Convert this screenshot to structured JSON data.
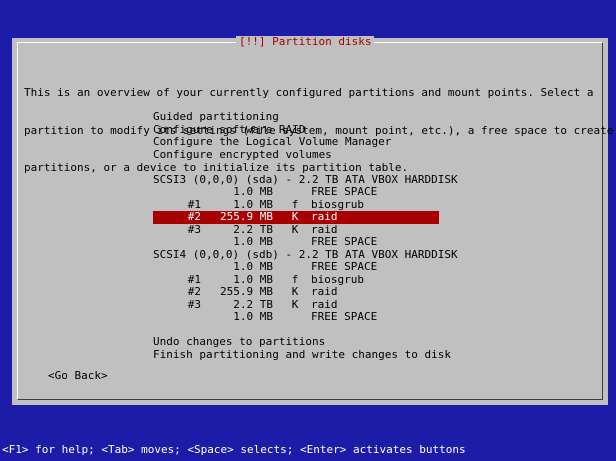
{
  "dialog": {
    "title": "[!!] Partition disks",
    "intro": [
      "This is an overview of your currently configured partitions and mount points. Select a",
      "partition to modify its settings (file system, mount point, etc.), a free space to create",
      "partitions, or a device to initialize its partition table."
    ]
  },
  "menu": {
    "actions": [
      "Guided partitioning",
      "Configure software RAID",
      "Configure the Logical Volume Manager",
      "Configure encrypted volumes"
    ],
    "disks": [
      {
        "header": "SCSI3 (0,0,0) (sda) - 2.2 TB ATA VBOX HARDDISK",
        "partitions": [
          {
            "num": "",
            "size": "1.0 MB",
            "flag": "",
            "use": "FREE SPACE"
          },
          {
            "num": "#1",
            "size": "1.0 MB",
            "flag": "f",
            "use": "biosgrub"
          },
          {
            "num": "#2",
            "size": "255.9 MB",
            "flag": "K",
            "use": "raid",
            "selected": true
          },
          {
            "num": "#3",
            "size": "2.2 TB",
            "flag": "K",
            "use": "raid"
          },
          {
            "num": "",
            "size": "1.0 MB",
            "flag": "",
            "use": "FREE SPACE"
          }
        ]
      },
      {
        "header": "SCSI4 (0,0,0) (sdb) - 2.2 TB ATA VBOX HARDDISK",
        "partitions": [
          {
            "num": "",
            "size": "1.0 MB",
            "flag": "",
            "use": "FREE SPACE"
          },
          {
            "num": "#1",
            "size": "1.0 MB",
            "flag": "f",
            "use": "biosgrub"
          },
          {
            "num": "#2",
            "size": "255.9 MB",
            "flag": "K",
            "use": "raid"
          },
          {
            "num": "#3",
            "size": "2.2 TB",
            "flag": "K",
            "use": "raid"
          },
          {
            "num": "",
            "size": "1.0 MB",
            "flag": "",
            "use": "FREE SPACE"
          }
        ]
      }
    ],
    "footer_actions": [
      "Undo changes to partitions",
      "Finish partitioning and write changes to disk"
    ]
  },
  "go_back": "<Go Back>",
  "status_bar": "<F1> for help; <Tab> moves; <Space> selects; <Enter> activates buttons",
  "colors": {
    "background": "#1c1ca8",
    "dialog": "#c0c0c0",
    "title": "#a80000",
    "selection": "#a80000"
  }
}
